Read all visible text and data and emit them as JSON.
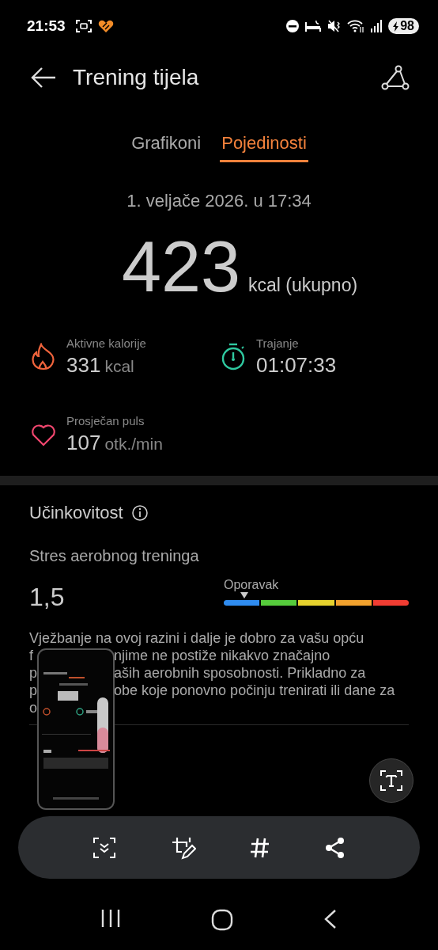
{
  "status_bar": {
    "time": "21:53",
    "battery": "98"
  },
  "header": {
    "title": "Trening tijela"
  },
  "tabs": [
    {
      "label": "Grafikoni",
      "selected": false
    },
    {
      "label": "Pojedinosti",
      "selected": true
    }
  ],
  "summary": {
    "date": "1. veljače 2026. u 17:34",
    "total": "423",
    "unit": "kcal (ukupno)"
  },
  "metrics": [
    {
      "kind": "flame",
      "color": "#f0643c",
      "label": "Aktivne kalorije",
      "value": "331",
      "unit": "kcal"
    },
    {
      "kind": "stopwatch",
      "color": "#2fc9a0",
      "label": "Trajanje",
      "value": "01:07:33"
    },
    {
      "kind": "heart",
      "color": "#f0466e",
      "label": "Prosječan puls",
      "value": "107",
      "unit": "otk./min"
    }
  ],
  "effectiveness": {
    "title": "Učinkovitost",
    "metric": "Stres aerobnog treninga",
    "value": "1,5",
    "scale_label": "Oporavak",
    "segments": [
      {
        "color": "#2f8cf0"
      },
      {
        "color": "#56cc3c"
      },
      {
        "color": "#e6d22e"
      },
      {
        "color": "#f2a22e"
      },
      {
        "color": "#f03c32"
      }
    ],
    "paragraph_lines": [
      {
        "left": "Vježbanje na ovoj razini i dalje je dobro za vašu opću"
      },
      {
        "left": "f",
        "right": "njime ne postiže nikakvo značajno"
      },
      {
        "left": "p",
        "right": "aših aerobnih sposobnosti. Prikladno za"
      },
      {
        "left": "p",
        "right": "obe koje ponovno počinju trenirati ili dane za"
      },
      {
        "left": "o"
      }
    ]
  }
}
